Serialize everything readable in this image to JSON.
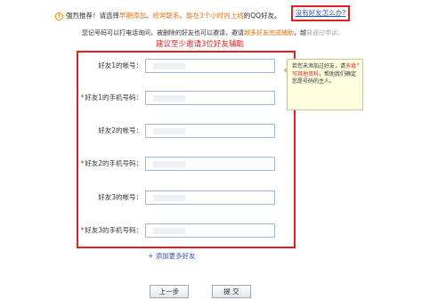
{
  "tip": {
    "p1": "强烈推荐！请选择",
    "h1": "早期添加",
    "s1": "、",
    "h2": "经常联系",
    "s2": "、",
    "h3": "能在3个小时内上线",
    "p2": "的QQ好友。",
    "help_link": "没有好友怎么办?"
  },
  "desc": {
    "part1": "您记号码可以打电话询问，被删除的好友也可以邀请，邀请",
    "highlight": "越多好友完成辅助",
    "part2": "，越",
    "tail": "易通过申诉。"
  },
  "hint": "建议至少邀请3位好友辅助",
  "rows": [
    {
      "label": "好友1的帐号：",
      "required": false
    },
    {
      "label": "好友1的手机号码：",
      "required": true
    },
    {
      "label": "好友2的帐号：",
      "required": false
    },
    {
      "label": "好友2的手机号码：",
      "required": true
    },
    {
      "label": "好友3的帐号：",
      "required": false
    },
    {
      "label": "好友3的手机号码：",
      "required": true
    }
  ],
  "star": "*",
  "add_more": "+ 添加更多好友",
  "buttons": {
    "prev": "上一步",
    "submit": "提 交"
  },
  "tooltip": {
    "close": "x",
    "p1": "若您未添加过好友，请",
    "hl": "多填写其他资料",
    "p2": "，帮助我们确定您是号码的主人。"
  },
  "colors": {
    "highlight_red": "#e02020",
    "link_blue": "#2a57b8",
    "accent_orange": "#e8700b"
  }
}
